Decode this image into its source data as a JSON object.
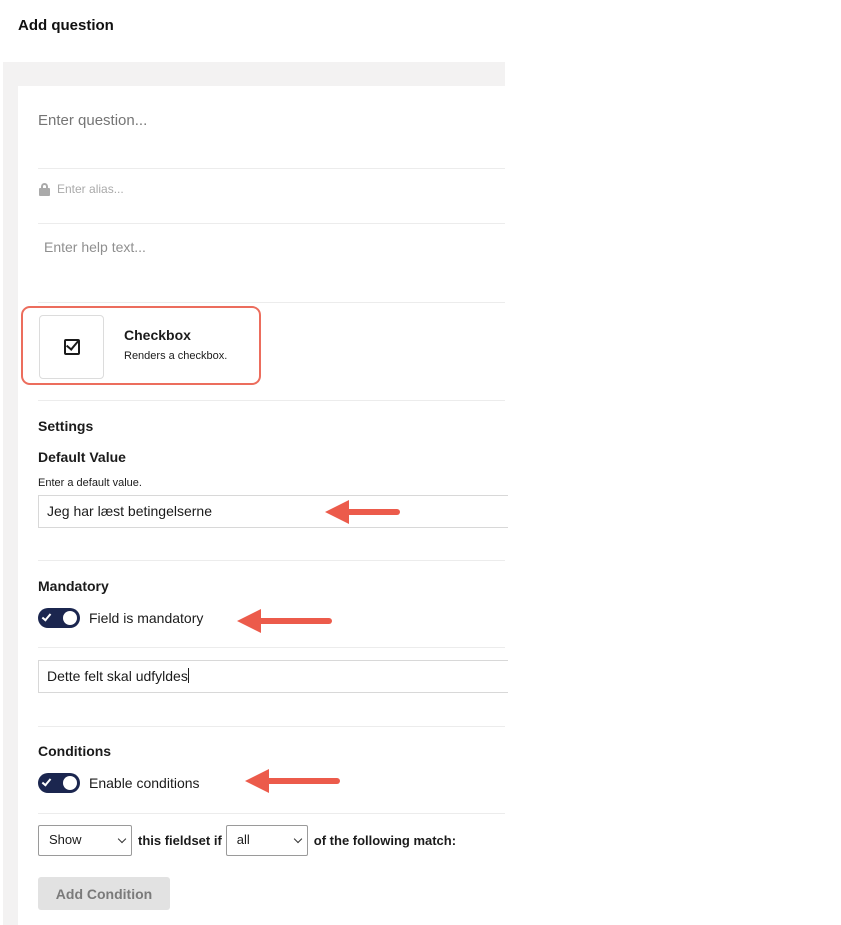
{
  "page": {
    "title": "Add question"
  },
  "question": {
    "placeholder": "Enter question...",
    "alias_placeholder": "Enter alias...",
    "help_placeholder": "Enter help text..."
  },
  "field_type": {
    "icon": "checkbox-icon",
    "name": "Checkbox",
    "description": "Renders a checkbox."
  },
  "settings": {
    "title": "Settings",
    "default_value": {
      "label": "Default Value",
      "description": "Enter a default value.",
      "value": "Jeg har læst betingelserne"
    }
  },
  "mandatory": {
    "title": "Mandatory",
    "toggle_label": "Field is mandatory",
    "toggle_on": true,
    "message_value": "Dette felt skal udfyldes"
  },
  "conditions": {
    "title": "Conditions",
    "toggle_label": "Enable conditions",
    "toggle_on": true,
    "action_select": "Show",
    "text_1": "this fieldset if",
    "match_select": "all",
    "text_2": "of the following match:",
    "add_button": "Add Condition"
  },
  "colors": {
    "highlight": "#ec6d5d",
    "arrow": "#ec5b4b",
    "toggle_on": "#1b264f"
  }
}
